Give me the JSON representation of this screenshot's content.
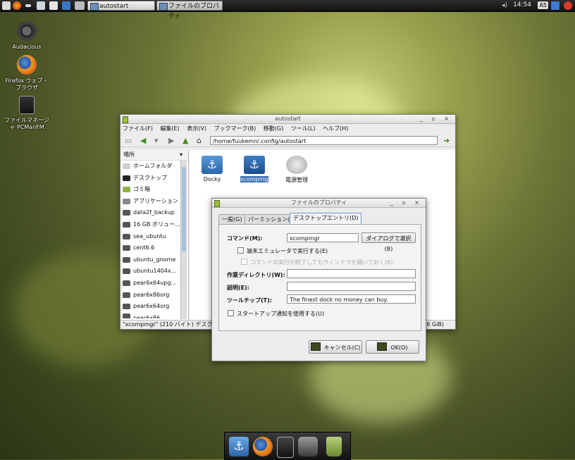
{
  "top_panel": {
    "tasks": [
      {
        "label": "autostart",
        "active": true
      },
      {
        "label": "ファイルのプロパティ",
        "active": false
      }
    ],
    "clock": "14:54",
    "tray_ime": "A5"
  },
  "desktop_icons": [
    {
      "label": "Audacious",
      "icon": "audacious-icon"
    },
    {
      "label": "Firefox ウェブ・ブラウザ",
      "icon": "firefox-icon"
    },
    {
      "label": "ファイルマネージャ PCManFM",
      "icon": "file-manager-icon"
    }
  ],
  "file_manager": {
    "title": "autostart",
    "menu": [
      "ファイル(F)",
      "編集(E)",
      "表示(V)",
      "ブックマーク(B)",
      "移動(G)",
      "ツール(L)",
      "ヘルプ(H)"
    ],
    "path": "/home/fuukemn/.config/autostart",
    "sidebar_header": "場所",
    "sidebar_items": [
      {
        "label": "ホームフォルダ",
        "icon": "home-icon"
      },
      {
        "label": "デスクトップ",
        "icon": "desktop-icon"
      },
      {
        "label": "ゴミ箱",
        "icon": "trash-icon"
      },
      {
        "label": "アプリケーション",
        "icon": "applications-icon"
      },
      {
        "label": "data2f_backup",
        "icon": "drive-icon"
      },
      {
        "label": "16 GB ボリュー…",
        "icon": "drive-icon"
      },
      {
        "label": "sea_ubuntu",
        "icon": "drive-icon"
      },
      {
        "label": "cent6.6",
        "icon": "drive-icon"
      },
      {
        "label": "ubuntu_gnome",
        "icon": "drive-icon"
      },
      {
        "label": "ubuntu1404x…",
        "icon": "drive-icon"
      },
      {
        "label": "pear6x64upg…",
        "icon": "drive-icon"
      },
      {
        "label": "pear6x86org",
        "icon": "drive-icon"
      },
      {
        "label": "pear6x64org",
        "icon": "drive-icon"
      },
      {
        "label": "pear6x86",
        "icon": "drive-icon"
      }
    ],
    "files": [
      {
        "label": "Docky",
        "selected": false
      },
      {
        "label": "xcompmgr",
        "selected": true
      },
      {
        "label": "電源管理",
        "selected": false
      }
    ],
    "status_left": "\"xcompmgr\" (210 バイト) デスクトップ",
    "status_right": ".6 GiB)"
  },
  "dialog": {
    "title": "ファイルのプロパティ",
    "tabs": [
      "一般(G)",
      "パーミッション(P)",
      "デスクトップエントリ(D)"
    ],
    "active_tab": 2,
    "command_label": "コマンド(M):",
    "command_value": "xcompmgr",
    "browse_label": "ダイアログで選択(B)",
    "terminal_check": "端末エミュレータで実行する(E)",
    "keep_open_check": "コマンドの実行が終了してもウィンドウを開いておく(K)",
    "workdir_label": "作業ディレクトリ(W):",
    "workdir_value": "",
    "desc_label": "説明(E):",
    "desc_value": "",
    "tooltip_label": "ツールチップ(T):",
    "tooltip_value": "The finest dock no money can buy.",
    "startup_check": "スタートアップ通知を使用する(U)",
    "cancel_label": "キャンセル(C)",
    "ok_label": "OK(O)"
  },
  "dock": {
    "items": [
      "docky-anchor-icon",
      "firefox-icon",
      "file-manager-icon",
      "camera-icon",
      "trash-icon"
    ]
  }
}
